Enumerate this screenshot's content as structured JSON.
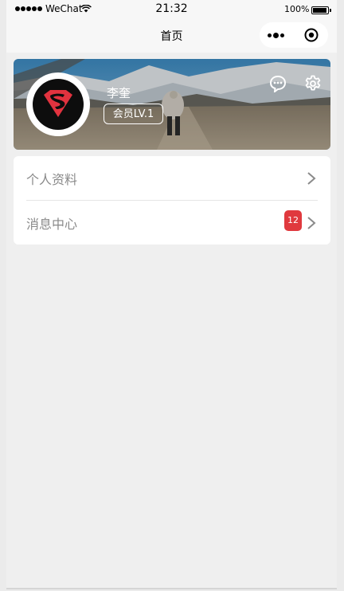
{
  "status_bar": {
    "carrier": "WeChat",
    "time": "21:32",
    "battery": "100%"
  },
  "nav": {
    "title": "首页"
  },
  "profile": {
    "name": "李奎",
    "level": "会员LV.1"
  },
  "menu": [
    {
      "label": "个人资料"
    },
    {
      "label": "消息中心",
      "badge": "12"
    }
  ],
  "colors": {
    "badge": "#e0393e",
    "page_bg": "#efefef",
    "menu_text": "#8a8a8a"
  },
  "icons": [
    "signal-icon",
    "wifi-icon",
    "battery-icon",
    "more-icon",
    "close-target-icon",
    "superman-logo",
    "chat-icon",
    "gear-icon",
    "chevron-right-icon"
  ]
}
